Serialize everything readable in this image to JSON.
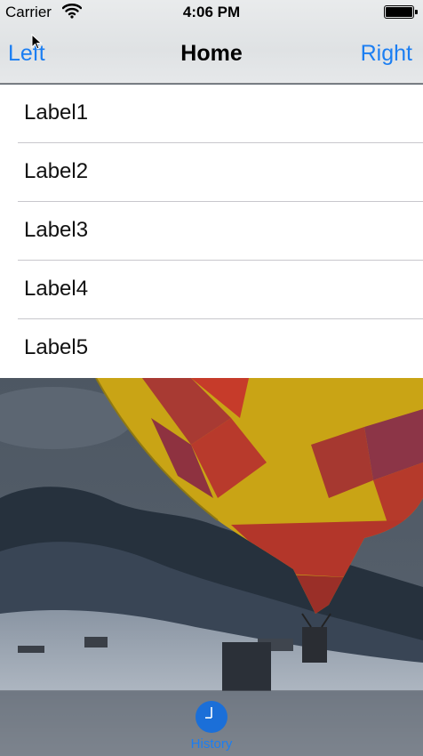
{
  "status_bar": {
    "carrier": "Carrier",
    "time": "4:06 PM",
    "wifi_icon": "wifi-icon",
    "battery_icon": "battery-icon"
  },
  "nav_bar": {
    "left": "Left",
    "title": "Home",
    "right": "Right"
  },
  "list": {
    "items": [
      {
        "label": "Label1"
      },
      {
        "label": "Label2"
      },
      {
        "label": "Label3"
      },
      {
        "label": "Label4"
      },
      {
        "label": "Label5"
      }
    ]
  },
  "tab_bar": {
    "items": [
      {
        "label": "History",
        "icon": "clock-icon"
      }
    ]
  },
  "colors": {
    "accent": "#1b7ef2",
    "list_background": "#ffffff",
    "separator": "#c8c7cc"
  }
}
